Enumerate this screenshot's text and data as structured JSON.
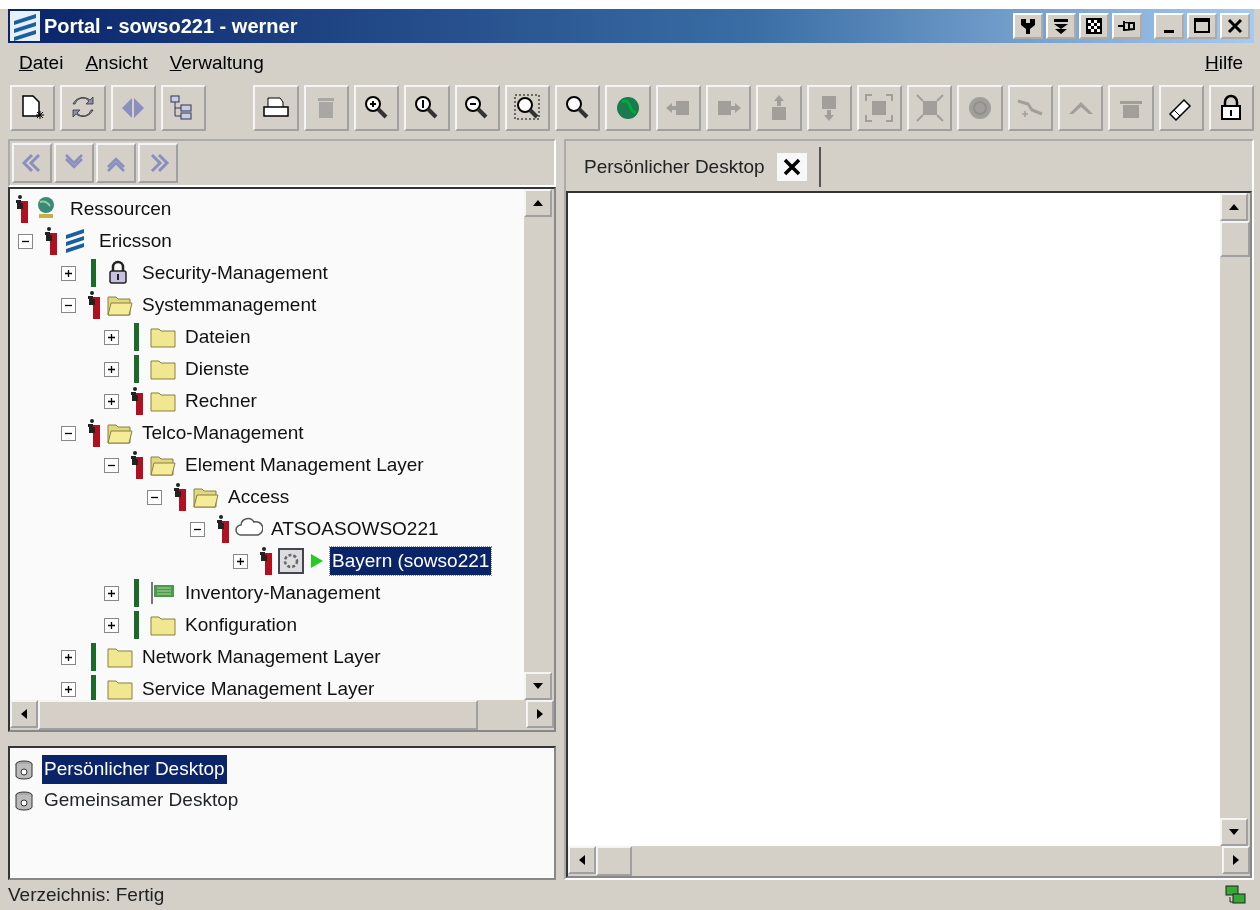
{
  "window": {
    "title": "Portal - sowso221 - werner"
  },
  "menu": {
    "left": [
      "Datei",
      "Ansicht",
      "Verwaltung"
    ],
    "right": [
      "Hilfe"
    ]
  },
  "toolbar": [
    {
      "disabled": false
    },
    {
      "disabled": false
    },
    {
      "disabled": false
    },
    {
      "disabled": false
    },
    {
      "disabled": false
    },
    {
      "disabled": true
    },
    {
      "disabled": false
    },
    {
      "disabled": false
    },
    {
      "disabled": false
    },
    {
      "disabled": false
    },
    {
      "disabled": false
    },
    {
      "disabled": false
    },
    {
      "disabled": true
    },
    {
      "disabled": true
    },
    {
      "disabled": true
    },
    {
      "disabled": true
    },
    {
      "disabled": true
    },
    {
      "disabled": true
    },
    {
      "disabled": true
    },
    {
      "disabled": true
    },
    {
      "disabled": true
    },
    {
      "disabled": true
    },
    {
      "disabled": false
    },
    {
      "disabled": false
    }
  ],
  "tree": [
    {
      "label": "Ressourcen",
      "alarm": true,
      "kind": "globe",
      "selected": false,
      "children": [
        {
          "label": "Ericsson",
          "alarm": true,
          "kind": "company",
          "selected": false,
          "expanded": true,
          "children": [
            {
              "label": "Security-Management",
              "alarm": false,
              "kind": "lock",
              "selected": false,
              "expanded": false
            },
            {
              "label": "Systemmanagement",
              "alarm": true,
              "kind": "folder",
              "selected": false,
              "expanded": true,
              "children": [
                {
                  "label": "Dateien",
                  "alarm": false,
                  "kind": "folder",
                  "selected": false,
                  "expanded": false
                },
                {
                  "label": "Dienste",
                  "alarm": false,
                  "kind": "folder",
                  "selected": false,
                  "expanded": false
                },
                {
                  "label": "Rechner",
                  "alarm": true,
                  "kind": "folder",
                  "selected": false,
                  "expanded": false
                }
              ]
            },
            {
              "label": "Telco-Management",
              "alarm": true,
              "kind": "folder",
              "selected": false,
              "expanded": true,
              "children": [
                {
                  "label": "Element Management Layer",
                  "alarm": true,
                  "kind": "folder",
                  "selected": false,
                  "expanded": true,
                  "children": [
                    {
                      "label": "Access",
                      "alarm": true,
                      "kind": "folder",
                      "selected": false,
                      "expanded": true,
                      "children": [
                        {
                          "label": "ATSOASOWSO221",
                          "alarm": true,
                          "kind": "cloud",
                          "selected": false,
                          "expanded": true,
                          "children": [
                            {
                              "label": "Bayern (sowso221",
                              "alarm": true,
                              "kind": "device",
                              "selected": true,
                              "expanded": false
                            }
                          ]
                        }
                      ]
                    }
                  ]
                },
                {
                  "label": "Inventory-Management",
                  "alarm": false,
                  "kind": "inventory",
                  "selected": false,
                  "expanded": false
                },
                {
                  "label": "Konfiguration",
                  "alarm": false,
                  "kind": "folder",
                  "selected": false,
                  "expanded": false
                }
              ]
            },
            {
              "label": "Network Management Layer",
              "alarm": false,
              "kind": "folder",
              "selected": false,
              "expanded": false
            },
            {
              "label": "Service Management Layer",
              "alarm": false,
              "kind": "folder",
              "selected": false,
              "expanded": false
            }
          ]
        }
      ]
    }
  ],
  "desktops": [
    {
      "label": "Persönlicher Desktop",
      "selected": true
    },
    {
      "label": "Gemeinsamer Desktop",
      "selected": false
    }
  ],
  "tabs": [
    {
      "label": "Persönlicher Desktop",
      "selected": true
    }
  ],
  "status_bar": {
    "text": "Verzeichnis: Fertig"
  }
}
